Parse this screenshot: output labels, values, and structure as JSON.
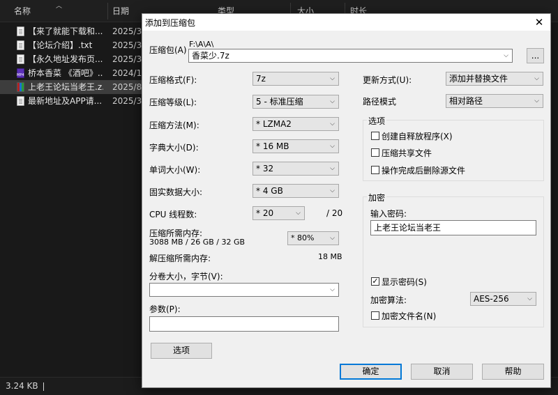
{
  "explorer": {
    "columns": [
      "名称",
      "日期",
      "类型",
      "大小",
      "时长"
    ],
    "files": [
      {
        "icon": "doc-file-icon",
        "name": "【来了就能下载和...",
        "date": "2025/3/"
      },
      {
        "icon": "doc-file-icon",
        "name": "【论坛介绍】.txt",
        "date": "2025/3/"
      },
      {
        "icon": "doc-file-icon",
        "name": "【永久地址发布页...",
        "date": "2025/3/"
      },
      {
        "icon": "mp4-file-icon",
        "name": "桥本香菜 《酒吧》...",
        "date": "2024/11"
      },
      {
        "icon": "rar-archive-icon",
        "name": "上老王论坛当老王.z...",
        "date": "2025/8/"
      },
      {
        "icon": "doc-file-icon",
        "name": "最新地址及APP请...",
        "date": "2025/3/"
      }
    ],
    "status_size": "3.24 KB"
  },
  "dialog": {
    "title": "添加到压缩包",
    "close_glyph": "✕",
    "archive_label": "压缩包(A)",
    "archive_path": "F:\\A\\A\\",
    "archive_name": "香菜少.7z",
    "browse_label": "...",
    "format_label": "压缩格式(F):",
    "format_value": "7z",
    "level_label": "压缩等级(L):",
    "level_value": "5 - 标准压缩",
    "method_label": "压缩方法(M):",
    "method_value": "* LZMA2",
    "dict_label": "字典大小(D):",
    "dict_value": "* 16 MB",
    "word_label": "单词大小(W):",
    "word_value": "* 32",
    "solid_label": "固实数据大小:",
    "solid_value": "* 4 GB",
    "threads_label": "CPU 线程数:",
    "threads_value": "* 20",
    "threads_total": "/ 20",
    "mem_label": "压缩所需内存:",
    "mem_value": "3088 MB / 26 GB / 32 GB",
    "mem_percent": "* 80%",
    "decomp_label": "解压缩所需内存:",
    "decomp_value": "18 MB",
    "volume_label": "分卷大小，字节(V):",
    "volume_value": "",
    "params_label": "参数(P):",
    "params_value": "",
    "options_button": "选项",
    "update_label": "更新方式(U):",
    "update_value": "添加并替换文件",
    "pathmode_label": "路径模式",
    "pathmode_value": "相对路径",
    "options_group": "选项",
    "opt_sfx": "创建自释放程序(X)",
    "opt_shared": "压缩共享文件",
    "opt_delete": "操作完成后删除源文件",
    "encrypt_group": "加密",
    "password_label": "输入密码:",
    "password_value": "上老王论坛当老王",
    "show_password": "显示密码(S)",
    "show_password_checked": "✓",
    "enc_method_label": "加密算法:",
    "enc_method_value": "AES-256",
    "encrypt_names": "加密文件名(N)",
    "ok_button": "确定",
    "cancel_button": "取消",
    "help_button": "帮助",
    "dropdown_glyph": "⌵"
  }
}
